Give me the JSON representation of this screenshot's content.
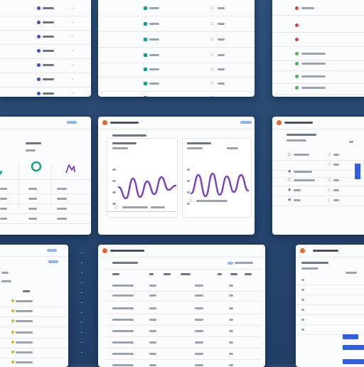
{
  "screen": {
    "label": "UI dashboard collage",
    "background_color": "#27476f"
  },
  "colors": {
    "accent_purple": "#7b3fc4",
    "accent_teal": "#1aa38a",
    "accent_blue": "#2f5fe0",
    "accent_orange": "#e8662c",
    "status_green": "#3fb950",
    "status_red": "#d94141"
  },
  "cards": [
    {
      "id": "top-left",
      "kind": "list",
      "icon_colors": [
        "#5b3fc4",
        "#5b3fc4",
        "#5b3fc4",
        "#3a4fd0",
        "#3a4fd0",
        "#3a4fd0",
        "#3a4fd0"
      ]
    },
    {
      "id": "top-center",
      "kind": "table",
      "icon_colors": [
        "#1aa38a",
        "#1aa38a",
        "#1aa38a",
        "#1aa38a",
        "#1aa38a",
        "#1aa38a",
        "#1aa38a"
      ]
    },
    {
      "id": "top-right",
      "kind": "status-list",
      "icon_colors": [
        "#d94141",
        "#d94141",
        "#d94141",
        "#3fb950",
        "#3fb950",
        "#3fb950",
        "#3fb950"
      ]
    },
    {
      "id": "middle-left",
      "kind": "donut-widgets"
    },
    {
      "id": "middle-center",
      "kind": "wave-charts"
    },
    {
      "id": "middle-right",
      "kind": "settings-list"
    },
    {
      "id": "bottom-left",
      "kind": "sidebar-list"
    },
    {
      "id": "bottom-center",
      "kind": "data-table"
    },
    {
      "id": "bottom-right",
      "kind": "bar-list"
    }
  ],
  "charts": {
    "left_wave": {
      "series_color": "#7b3fc4",
      "values": [
        0.55,
        0.15,
        0.85,
        0.2,
        0.75,
        0.3,
        0.9,
        0.45,
        0.6
      ]
    },
    "right_wave": {
      "series_color": "#7b3fc4",
      "values": [
        0.2,
        0.85,
        0.1,
        0.9,
        0.15,
        0.8,
        0.25,
        0.85,
        0.3
      ]
    },
    "mini_wave": {
      "series_color": "#7b3fc4"
    },
    "donut": {
      "color": "#1aa38a"
    }
  }
}
